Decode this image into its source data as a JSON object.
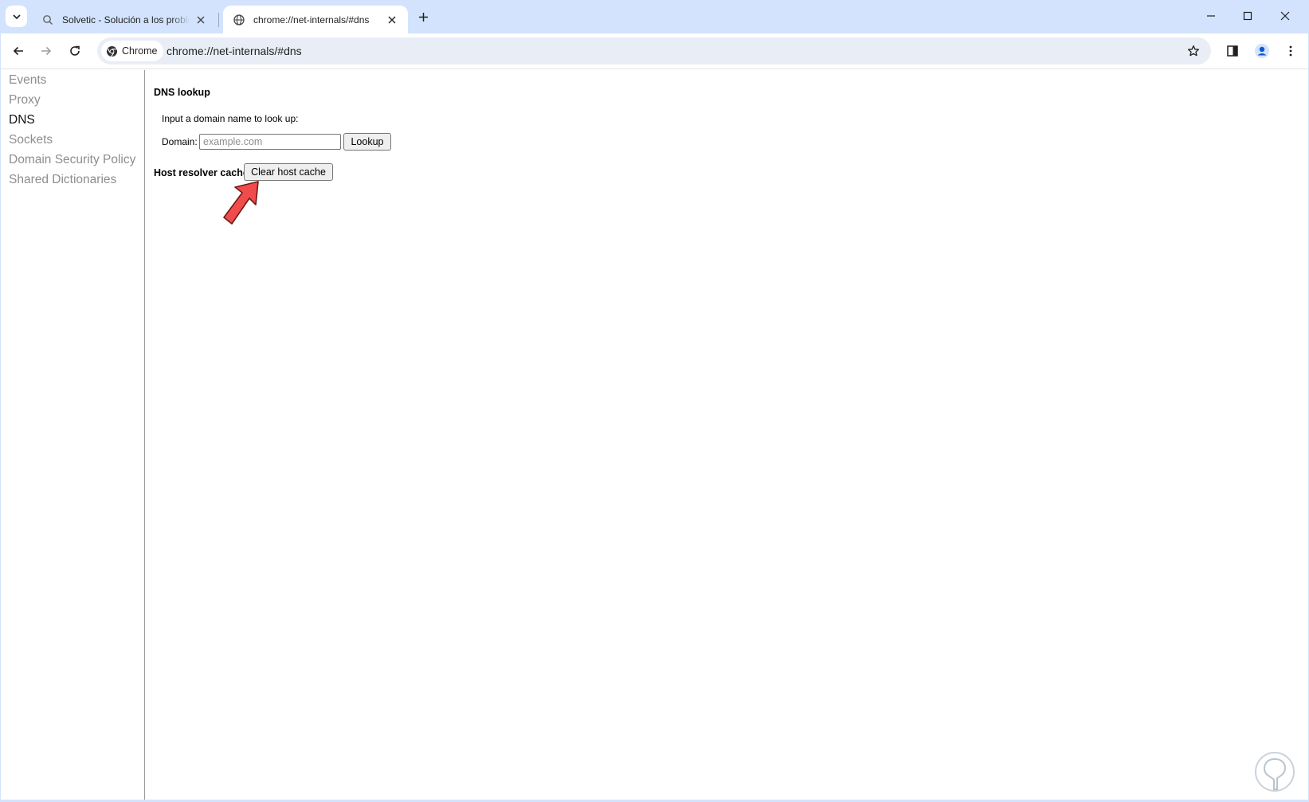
{
  "tabs": [
    {
      "title": "Solvetic - Solución a los problemas",
      "favicon": "search-icon",
      "active": false
    },
    {
      "title": "chrome://net-internals/#dns",
      "favicon": "globe-icon",
      "active": true
    }
  ],
  "toolbar": {
    "chip_label": "Chrome",
    "url": "chrome://net-internals/#dns"
  },
  "sidebar": {
    "items": [
      {
        "label": "Events",
        "selected": false
      },
      {
        "label": "Proxy",
        "selected": false
      },
      {
        "label": "DNS",
        "selected": true
      },
      {
        "label": "Sockets",
        "selected": false
      },
      {
        "label": "Domain Security Policy",
        "selected": false
      },
      {
        "label": "Shared Dictionaries",
        "selected": false
      }
    ]
  },
  "dns": {
    "heading": "DNS lookup",
    "instruction": "Input a domain name to look up:",
    "domain_label": "Domain:",
    "domain_placeholder": "example.com",
    "domain_value": "",
    "lookup_label": "Lookup",
    "cache_heading": "Host resolver cache",
    "clear_cache_label": "Clear host cache"
  },
  "colors": {
    "tabstrip": "#d3e3fd",
    "omnibox": "#e9eef6",
    "annotation_arrow": "#f24b4b"
  }
}
